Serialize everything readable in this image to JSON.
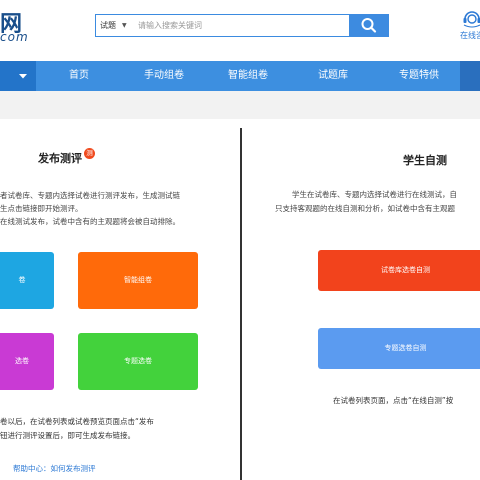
{
  "header": {
    "logo_text": "网",
    "logo_sub": "com",
    "search": {
      "type_label": "试题",
      "type_caret": "▼",
      "placeholder": "请输入搜索关键词"
    },
    "user_label": "在线咨"
  },
  "nav": {
    "items": [
      "首页",
      "手动组卷",
      "智能组卷",
      "试题库",
      "专题特供"
    ]
  },
  "publish": {
    "title": "发布测评",
    "badge": "测",
    "desc": [
      "者试卷库、专题内选择试卷进行测评发布，生成测试链",
      "生点击链接即开始测评。",
      "在线测试发布，试卷中含有的主观题将会被自动排除。"
    ],
    "tiles": [
      {
        "label": "卷",
        "color": "#1ea6e2"
      },
      {
        "label": "智能组卷",
        "color": "#ff6a0a"
      },
      {
        "label": "选卷",
        "color": "#c93ad4"
      },
      {
        "label": "专题选卷",
        "color": "#43d23c"
      }
    ],
    "note": [
      "卷以后，在试卷列表或试卷预览页面点击“发布",
      "钮进行测评设置后，即可生成发布链接。"
    ],
    "help": "帮助中心：如何发布测评"
  },
  "self_test": {
    "title": "学生自测",
    "desc": [
      "学生在试卷库、专题内选择试卷进行在线测试，自",
      "只支持客观题的在线自测和分析，如试卷中含有主观题"
    ],
    "tiles": [
      {
        "label": "试卷库选卷自测",
        "color": "#f2431c"
      },
      {
        "label": "专题选卷自测",
        "color": "#5b9bf0"
      }
    ],
    "note": "在试卷列表页面，点击“在线自测”按"
  },
  "colors": {
    "nav_bg": "#3d8fe0",
    "nav_dark": "#2374c9",
    "accent": "#3d8be0"
  }
}
